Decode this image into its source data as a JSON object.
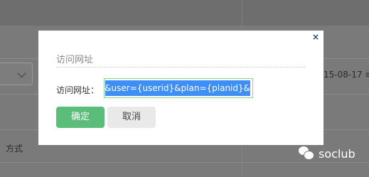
{
  "background": {
    "date_text": "15-08-17 ≡",
    "method_text": "方式"
  },
  "watermark": {
    "icon": "wechat-icon",
    "text": "soclub"
  },
  "dialog": {
    "close_label": "×",
    "title": "访问网址",
    "field_label": "访问网址：",
    "url_value": "eng&user={userid}&plan={planid}&",
    "ok_label": "确定",
    "cancel_label": "取消"
  },
  "colors": {
    "primary_button": "#5cbd7a",
    "selection": "#3e8ef7",
    "close_icon": "#1a4f8b",
    "overlay": "#7a7a7a"
  }
}
